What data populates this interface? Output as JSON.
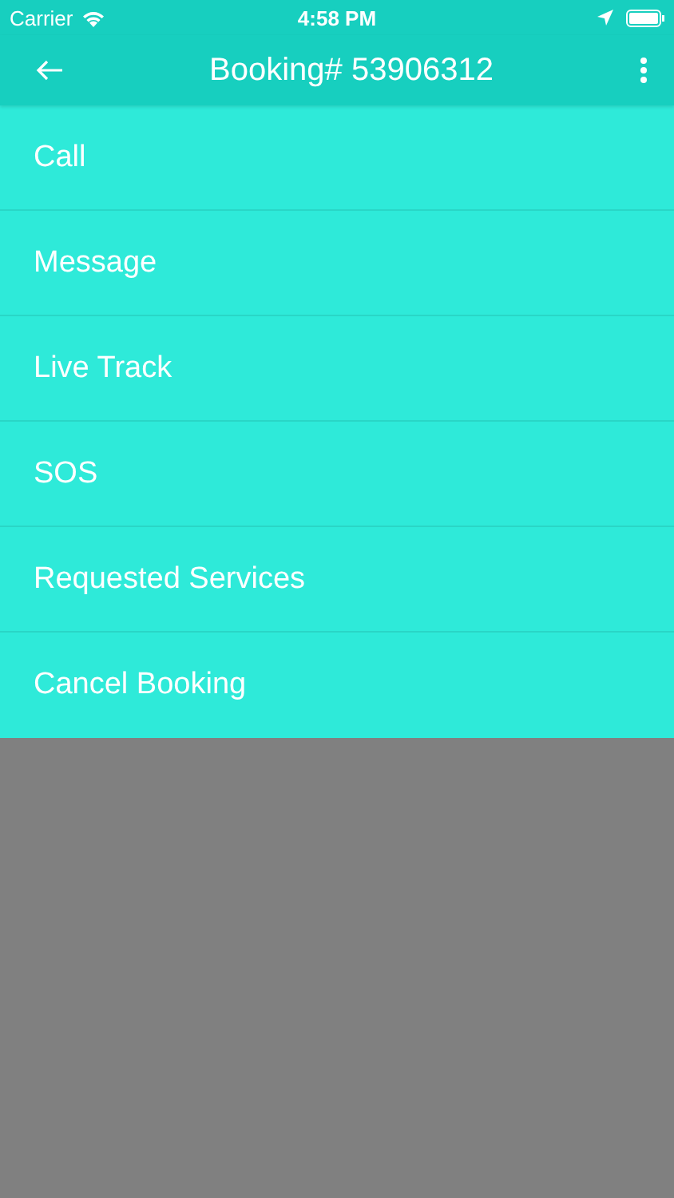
{
  "status_bar": {
    "carrier": "Carrier",
    "time": "4:58 PM"
  },
  "nav_bar": {
    "title": "Booking# 53906312"
  },
  "menu": {
    "items": [
      {
        "label": "Call"
      },
      {
        "label": "Message"
      },
      {
        "label": "Live Track"
      },
      {
        "label": "SOS"
      },
      {
        "label": "Requested Services"
      },
      {
        "label": "Cancel Booking"
      }
    ]
  }
}
